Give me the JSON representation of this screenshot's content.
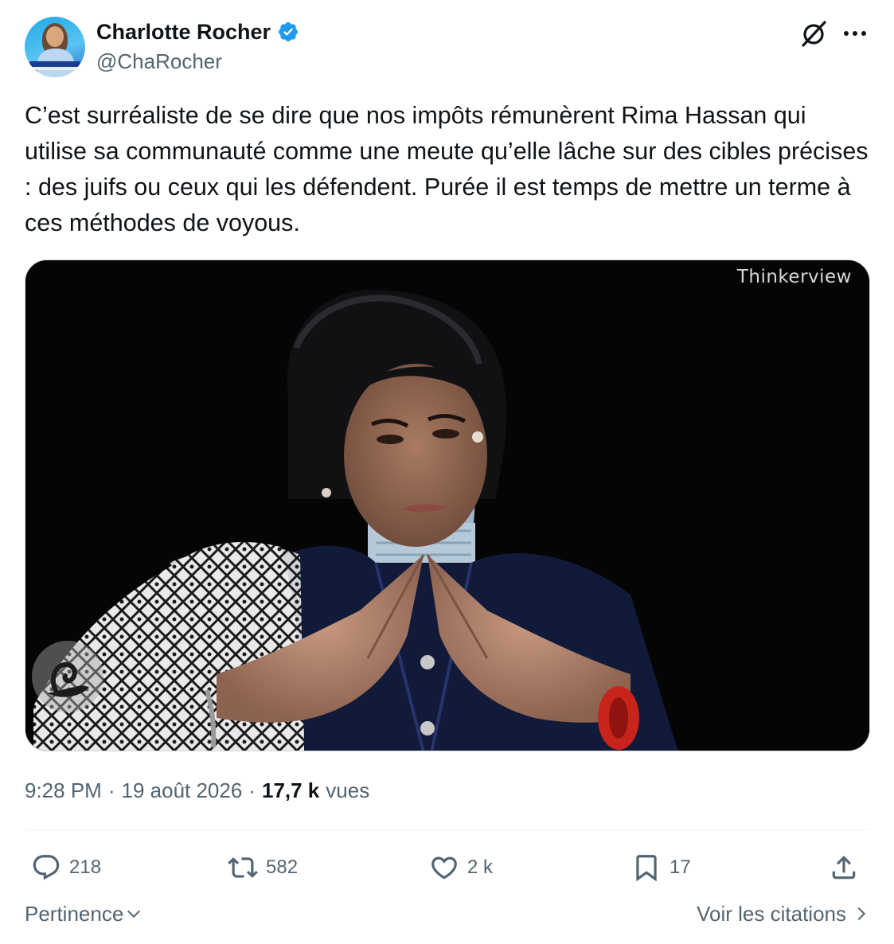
{
  "author": {
    "display_name": "Charlotte Rocher",
    "handle": "@ChaRocher",
    "verified": true
  },
  "header_icons": {
    "grok": "grok-slash-icon",
    "more": "more-dots-icon"
  },
  "tweet": {
    "text": "C’est surréaliste de se dire que nos impôts rémunèrent Rima Hassan qui utilise sa communauté comme une meute qu’elle lâche sur des cibles précises : des juifs ou ceux qui les défendent. Purée il est temps de mettre un terme à ces méthodes de voyous."
  },
  "media": {
    "watermark": "Thinkerview",
    "background": "#050506"
  },
  "meta": {
    "time": "9:28 PM",
    "separator": "·",
    "date": "19 août 2026",
    "views_count": "17,7 k",
    "views_label": "vues"
  },
  "actions": {
    "replies": "218",
    "reposts": "582",
    "likes": "2 k",
    "bookmarks": "17"
  },
  "footer": {
    "sort_label": "Pertinence",
    "quotes_label": "Voir les citations"
  },
  "colors": {
    "text": "#0f1419",
    "secondary": "#536471",
    "verified": "#1d9bf0",
    "border": "#cfd9de"
  }
}
